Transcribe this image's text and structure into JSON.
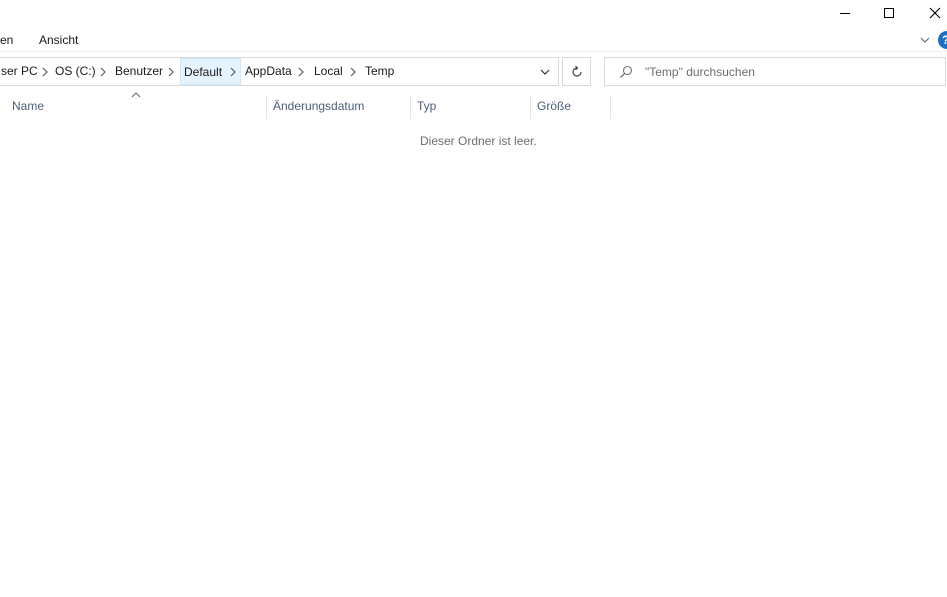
{
  "window": {
    "controls": {
      "minimize_icon": "minimize-icon",
      "maximize_icon": "maximize-icon",
      "close_icon": "close-icon"
    }
  },
  "ribbon": {
    "tabs": [
      {
        "label": "en"
      },
      {
        "label": "Ansicht"
      }
    ],
    "help_label": "?"
  },
  "address": {
    "crumbs": [
      {
        "label": "ser PC"
      },
      {
        "label": "OS (C:)"
      },
      {
        "label": "Benutzer"
      },
      {
        "label": "Default"
      },
      {
        "label": "AppData"
      },
      {
        "label": "Local"
      },
      {
        "label": "Temp"
      }
    ],
    "selected_index": 3
  },
  "search": {
    "placeholder": "\"Temp\" durchsuchen"
  },
  "columns": [
    {
      "label": "Name"
    },
    {
      "label": "Änderungsdatum"
    },
    {
      "label": "Typ"
    },
    {
      "label": "Größe"
    }
  ],
  "content": {
    "empty_message": "Dieser Ordner ist leer."
  },
  "colors": {
    "accent": "#1a6fc4",
    "selected_crumb_bg": "#e5f3ff",
    "header_text": "#4c607a",
    "muted_text": "#6d6d6d"
  }
}
